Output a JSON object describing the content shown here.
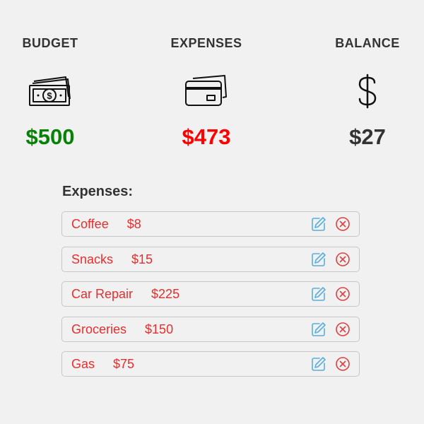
{
  "summary": {
    "budget": {
      "label": "BUDGET",
      "amount": "$500",
      "icon": "money-bill-icon",
      "color": "#078207"
    },
    "expenses": {
      "label": "EXPENSES",
      "amount": "$473",
      "icon": "credit-card-icon",
      "color": "#ff0000"
    },
    "balance": {
      "label": "BALANCE",
      "amount": "$27",
      "icon": "dollar-sign-icon",
      "color": "#333333"
    }
  },
  "expenses_heading": "Expenses:",
  "expenses": [
    {
      "name": "Coffee",
      "amount": "$8"
    },
    {
      "name": "Snacks",
      "amount": "$15"
    },
    {
      "name": "Car Repair",
      "amount": "$225"
    },
    {
      "name": "Groceries",
      "amount": "$150"
    },
    {
      "name": "Gas",
      "amount": "$75"
    }
  ],
  "actions": {
    "edit_icon": "edit-icon",
    "delete_icon": "delete-icon"
  },
  "colors": {
    "expense_text": "#e62e2e",
    "edit_icon": "#5aaedc",
    "delete_icon": "#e04040",
    "background": "#f1f1f1"
  }
}
